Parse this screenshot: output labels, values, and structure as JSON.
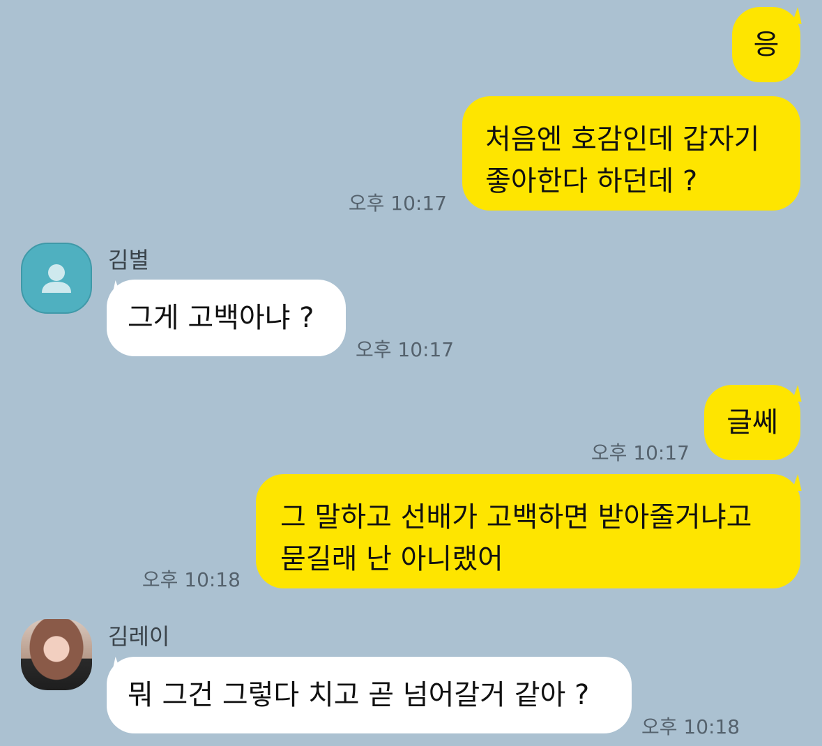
{
  "messages": [
    {
      "sender": "me",
      "text": "응",
      "time": ""
    },
    {
      "sender": "me",
      "text": "처음엔 호감인데 갑자기\n좋아한다 하던데 ?",
      "time": "오후 10:17"
    },
    {
      "sender": "김별",
      "text": "그게 고백아냐 ?",
      "time": "오후 10:17"
    },
    {
      "sender": "me",
      "text": "글쎄",
      "time": "오후 10:17"
    },
    {
      "sender": "me",
      "text": "그 말하고 선배가 고백하면 받아줄거냐고\n묻길래 난 아니랬어",
      "time": "오후 10:18"
    },
    {
      "sender": "김레이",
      "text": "뭐 그건 그렇다 치고 곧 넘어갈거 같아 ?",
      "time": "오후 10:18"
    }
  ],
  "contacts": {
    "kimbyeol": {
      "name": "김별",
      "avatar_icon": "default-person-icon"
    },
    "kimrei": {
      "name": "김레이",
      "avatar_icon": "profile-photo"
    }
  },
  "colors": {
    "background": "#abc1d1",
    "my_bubble": "#fee500",
    "their_bubble": "#ffffff"
  }
}
